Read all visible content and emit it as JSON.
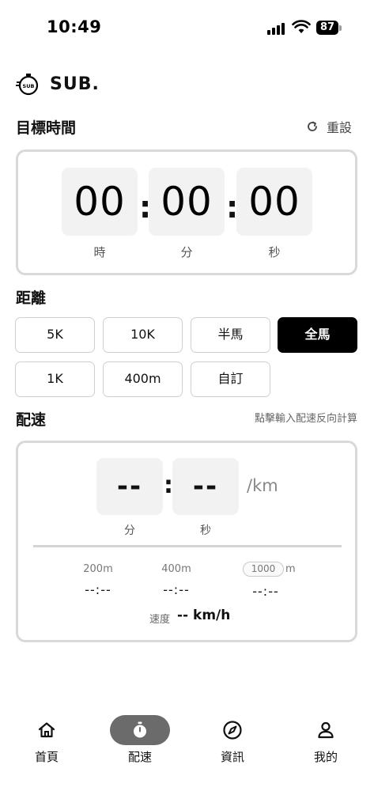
{
  "status_bar": {
    "time": "10:49",
    "battery": "87"
  },
  "app": {
    "title": "SUB."
  },
  "target_time": {
    "heading": "目標時間",
    "reset_label": "重設",
    "hours": "00",
    "minutes": "00",
    "seconds": "00",
    "hours_label": "時",
    "minutes_label": "分",
    "seconds_label": "秒",
    "separator": ":"
  },
  "distance": {
    "heading": "距離",
    "options": [
      "5K",
      "10K",
      "半馬",
      "全馬",
      "1K",
      "400m",
      "自訂"
    ],
    "selected": "全馬"
  },
  "pace": {
    "heading": "配速",
    "hint": "點擊輸入配速反向計算",
    "minutes": "--",
    "seconds": "--",
    "separator": ":",
    "unit": "/km",
    "minutes_label": "分",
    "seconds_label": "秒",
    "splits": [
      {
        "distance": "200m",
        "value": "--:--"
      },
      {
        "distance": "400m",
        "value": "--:--"
      },
      {
        "distance": "1000",
        "unit": "m",
        "value": "--:--"
      }
    ],
    "speed_label": "速度",
    "speed_value": "-- km/h"
  },
  "nav": {
    "items": [
      {
        "label": "首頁",
        "icon": "home-icon"
      },
      {
        "label": "配速",
        "icon": "stopwatch-icon"
      },
      {
        "label": "資訊",
        "icon": "compass-icon"
      },
      {
        "label": "我的",
        "icon": "user-icon"
      }
    ],
    "active": "配速"
  }
}
